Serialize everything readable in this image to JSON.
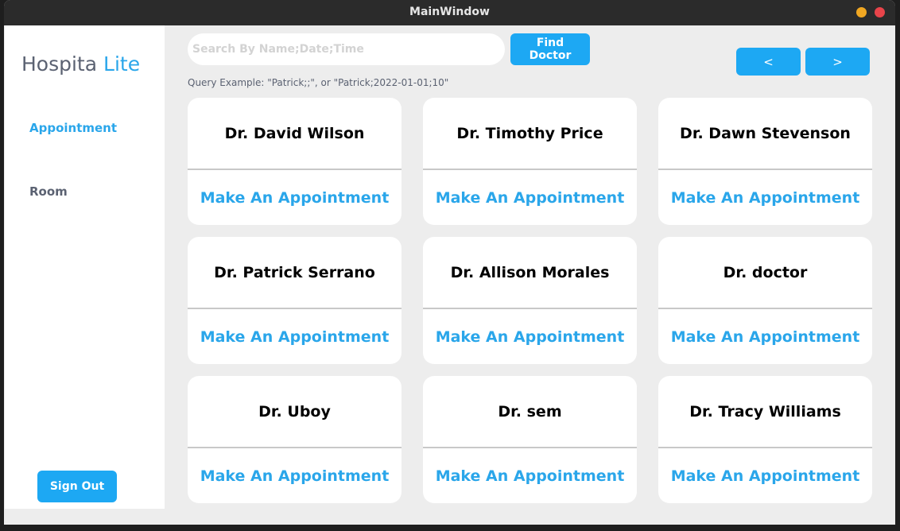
{
  "window": {
    "title": "MainWindow"
  },
  "sidebar": {
    "logo_main": "Hospita",
    "logo_accent": "Lite",
    "items": [
      {
        "label": "Appointment"
      },
      {
        "label": "Room"
      }
    ],
    "sign_out_label": "Sign Out"
  },
  "search": {
    "placeholder": "Search By Name;Date;Time",
    "value": "",
    "find_label": "Find Doctor",
    "hint": "Query Example: \"Patrick;;\", or \"Patrick;2022-01-01;10\""
  },
  "pager": {
    "prev_label": "<",
    "next_label": ">"
  },
  "doctors": [
    {
      "name": "Dr. David Wilson",
      "action": "Make An Appointment"
    },
    {
      "name": "Dr. Timothy Price",
      "action": "Make An Appointment"
    },
    {
      "name": "Dr. Dawn Stevenson",
      "action": "Make An Appointment"
    },
    {
      "name": "Dr. Patrick Serrano",
      "action": "Make An Appointment"
    },
    {
      "name": "Dr. Allison Morales",
      "action": "Make An Appointment"
    },
    {
      "name": "Dr. doctor",
      "action": "Make An Appointment"
    },
    {
      "name": "Dr. Uboy",
      "action": "Make An Appointment"
    },
    {
      "name": "Dr. sem",
      "action": "Make An Appointment"
    },
    {
      "name": "Dr. Tracy Williams",
      "action": "Make An Appointment"
    }
  ],
  "colors": {
    "accent": "#1da8f3",
    "text_muted": "#5b6272",
    "background": "#ededed"
  }
}
